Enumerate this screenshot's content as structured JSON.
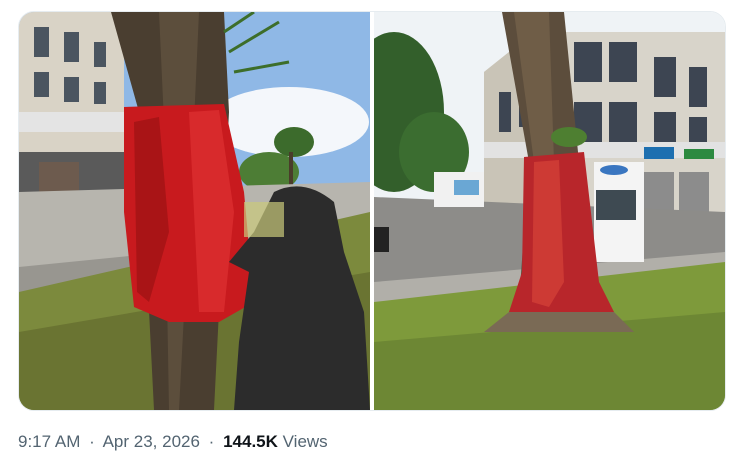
{
  "post": {
    "time": "9:17 AM",
    "separator": "·",
    "date": "Apr 23, 2026",
    "views_count": "144.5K",
    "views_label": "Views"
  },
  "media": {
    "photos": [
      {
        "name": "photo-tree-wrapped-red-cloth",
        "shop_signs": [
          "",
          ""
        ]
      },
      {
        "name": "photo-tree-painted-red",
        "shop_signs": [
          "",
          ""
        ]
      }
    ]
  },
  "colors": {
    "meta_text": "#536471",
    "views_text": "#0f1419",
    "red_cloth": "#c81a1e",
    "red_paint": "#b8262b"
  }
}
